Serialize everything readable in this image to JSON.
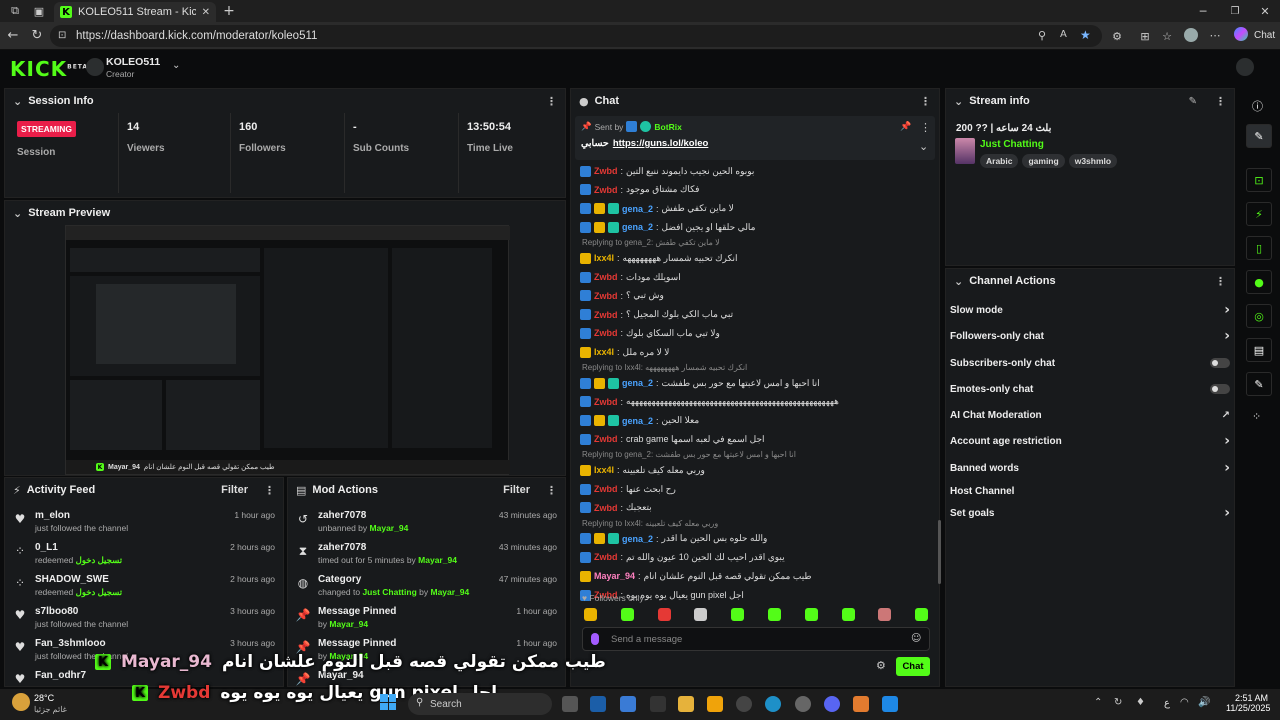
{
  "browser": {
    "tab_title": "KOLEO511 Stream - Kick Dashboa",
    "url": "https://dashboard.kick.com/moderator/koleo511",
    "chat_label": "Chat"
  },
  "header": {
    "logo": "KICK",
    "beta": "BETA",
    "channel": "KOLEO511",
    "role": "Creator"
  },
  "session": {
    "title": "Session Info",
    "status": "STREAMING",
    "status_label": "Session",
    "stats": [
      {
        "value": "14",
        "label": "Viewers"
      },
      {
        "value": "160",
        "label": "Followers"
      },
      {
        "value": "-",
        "label": "Sub Counts"
      },
      {
        "value": "13:50:54",
        "label": "Time Live"
      }
    ]
  },
  "preview": {
    "title": "Stream Preview",
    "overlay_user": "Mayar_94",
    "overlay_text": "طيب ممكن تقولي قصه قبل النوم علشان انام"
  },
  "activity": {
    "title": "Activity Feed",
    "filter": "Filter",
    "items": [
      {
        "name": "m_elon",
        "sub": "just followed the channel",
        "time": "1 hour ago",
        "icon": "heart"
      },
      {
        "name": "0_L1",
        "sub": "redeemed",
        "reward": "تسجيل دخول",
        "time": "2 hours ago",
        "icon": "redeem"
      },
      {
        "name": "SHADOW_SWE",
        "sub": "redeemed",
        "reward": "تسجيل دخول",
        "time": "2 hours ago",
        "icon": "redeem"
      },
      {
        "name": "s7lboo80",
        "sub": "just followed the channel",
        "time": "3 hours ago",
        "icon": "heart"
      },
      {
        "name": "Fan_3shmlooo",
        "sub": "just followed the channel",
        "time": "3 hours ago",
        "icon": "heart"
      },
      {
        "name": "Fan_odhr7",
        "sub": "",
        "time": "",
        "icon": "heart"
      }
    ]
  },
  "mod": {
    "title": "Mod Actions",
    "filter": "Filter",
    "items": [
      {
        "name": "zaher7078",
        "sub": "unbanned by",
        "by": "Mayar_94",
        "time": "43 minutes ago",
        "icon": "unban"
      },
      {
        "name": "zaher7078",
        "sub": "timed out for 5 minutes by",
        "by": "Mayar_94",
        "time": "43 minutes ago",
        "icon": "timeout"
      },
      {
        "name": "Category",
        "sub": "changed to",
        "cat": "Just Chatting",
        "sub2": "by",
        "by": "Mayar_94",
        "time": "47 minutes ago",
        "icon": "category"
      },
      {
        "name": "Message Pinned",
        "sub": "by",
        "by": "Mayar_94",
        "time": "1 hour ago",
        "icon": "pin"
      },
      {
        "name": "Message Pinned",
        "sub": "by",
        "by": "Mayar_94",
        "time": "1 hour ago",
        "icon": "pin"
      },
      {
        "name": "Mayar_94",
        "sub": "",
        "by": "",
        "time": "",
        "icon": "pin"
      }
    ]
  },
  "chat": {
    "title": "Chat",
    "pinned": {
      "sent_by": "Sent by",
      "bot": "BotRix",
      "text": "حسابي",
      "link": "https://guns.lol/koleo"
    },
    "messages": [
      {
        "u": "Zwbd",
        "c": "#e53935",
        "b": [
          "bb"
        ],
        "t": "بوبوه الحين نجيب دايموند ننيع التين"
      },
      {
        "u": "Zwbd",
        "c": "#e53935",
        "b": [
          "bb"
        ],
        "t": "فكاك مشتاق موجود"
      },
      {
        "u": "gena_2",
        "c": "#4aa3ff",
        "b": [
          "bb",
          "by",
          "bt"
        ],
        "t": "لا ماين تكفي طفش"
      },
      {
        "u": "gena_2",
        "c": "#4aa3ff",
        "b": [
          "bb",
          "by",
          "bt"
        ],
        "t": "مالي حلقها او يجين افضل"
      },
      {
        "u": "Ixx4l",
        "c": "#e9b300",
        "b": [
          "by"
        ],
        "t": "انكرك تحبيه شمسار ههههههههه",
        "r": "Replying to gena_2: لا ماين تكفي طفش"
      },
      {
        "u": "Zwbd",
        "c": "#e53935",
        "b": [
          "bb"
        ],
        "t": "اسويلك مودات"
      },
      {
        "u": "Zwbd",
        "c": "#e53935",
        "b": [
          "bb"
        ],
        "t": "وش تبي ؟"
      },
      {
        "u": "Zwbd",
        "c": "#e53935",
        "b": [
          "bb"
        ],
        "t": "تبي ماب الكي بلوك المجيل ؟"
      },
      {
        "u": "Zwbd",
        "c": "#e53935",
        "b": [
          "bb"
        ],
        "t": "ولا تبي ماب السكاي بلوك"
      },
      {
        "u": "Ixx4l",
        "c": "#e9b300",
        "b": [
          "by"
        ],
        "t": "لا لا مره ملل"
      },
      {
        "u": "gena_2",
        "c": "#4aa3ff",
        "b": [
          "bb",
          "by",
          "bt"
        ],
        "t": "انا احبها و امس لاعبتها مع حور بس طفشت",
        "r": "Replying to Ixx4l: انكرك تحبيه شمسار ههههههههه"
      },
      {
        "u": "Zwbd",
        "c": "#e53935",
        "b": [
          "bb"
        ],
        "t": "ههههههههههههههههههههههههههههههههههههههههههههههههههه"
      },
      {
        "u": "gena_2",
        "c": "#4aa3ff",
        "b": [
          "bb",
          "by",
          "bt"
        ],
        "t": "معلا الحين"
      },
      {
        "u": "Zwbd",
        "c": "#e53935",
        "b": [
          "bb"
        ],
        "t": "crab game اجل اسمع في لعبه اسمها"
      },
      {
        "u": "Ixx4l",
        "c": "#e9b300",
        "b": [
          "by"
        ],
        "t": "وربي معله كيف تلعبينه",
        "r": "Replying to gena_2: انا احبها و امس لاعبتها مع حور بس طفشت"
      },
      {
        "u": "Zwbd",
        "c": "#e53935",
        "b": [
          "bb"
        ],
        "t": "رح ابحث عنها"
      },
      {
        "u": "Zwbd",
        "c": "#e53935",
        "b": [
          "bb"
        ],
        "t": "بتعجبك"
      },
      {
        "u": "gena_2",
        "c": "#4aa3ff",
        "b": [
          "bb",
          "by",
          "bt"
        ],
        "t": "والله حلوه بس الحين ما اقدر",
        "r": "Replying to Ixx4l: وربي معله كيف تلعبينه"
      },
      {
        "u": "Zwbd",
        "c": "#e53935",
        "b": [
          "bb"
        ],
        "t": "يبوي اقدر احيب لك الحين 10 عيون والله تم"
      },
      {
        "u": "Mayar_94",
        "c": "#ff80c0",
        "b": [
          "by"
        ],
        "t": "طيب ممكن تقولي قصه قبل النوم علشان انام"
      },
      {
        "u": "Zwbd",
        "c": "#e53935",
        "b": [
          "bb"
        ],
        "t": "يعيال يوه يوه يوه gun pixel اجل"
      }
    ],
    "followers_only": "Followers only",
    "placeholder": "Send a message",
    "send": "Chat"
  },
  "stream_info": {
    "title": "Stream info",
    "stream_title": "بلث 24 ساعه | ?? 200",
    "category": "Just Chatting",
    "tags": [
      "Arabic",
      "gaming",
      "w3shmlo"
    ]
  },
  "channel_actions": {
    "title": "Channel Actions",
    "items": [
      {
        "label": "Slow mode",
        "ctrl": "arrow"
      },
      {
        "label": "Followers-only chat",
        "ctrl": "arrow"
      },
      {
        "label": "Subscribers-only chat",
        "ctrl": "toggle"
      },
      {
        "label": "Emotes-only chat",
        "ctrl": "toggle"
      },
      {
        "label": "AI Chat Moderation",
        "ctrl": "ext"
      },
      {
        "label": "Account age restriction",
        "ctrl": "arrow"
      },
      {
        "label": "Banned words",
        "ctrl": "arrow"
      },
      {
        "label": "Host Channel",
        "ctrl": "none"
      },
      {
        "label": "Set goals",
        "ctrl": "arrow"
      }
    ]
  },
  "captions": {
    "line1_user": "Mayar_94",
    "line1_text": "طيب ممكن تقولي قصه قبل النوم علشان انام",
    "line2_user": "Zwbd",
    "line2_text": "يعيال يوه يوه يوه gun pixel اجل"
  },
  "taskbar": {
    "temp": "28°C",
    "weather": "غائم جزئيا",
    "search": "Search",
    "time": "2:51 AM",
    "date": "11/25/2025",
    "lang": "ع"
  }
}
